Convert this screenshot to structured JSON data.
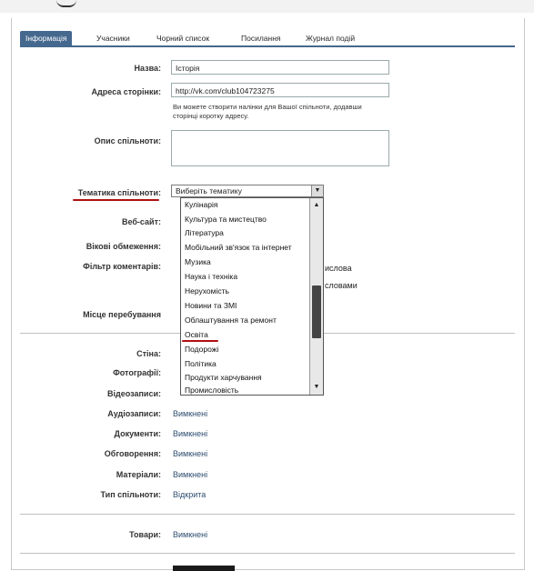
{
  "tabs": [
    {
      "label": "Інформація",
      "active": true
    },
    {
      "label": "Учасники"
    },
    {
      "label": "Чорний список"
    },
    {
      "label": "Посилання"
    },
    {
      "label": "Журнал подій"
    }
  ],
  "form": {
    "name_label": "Назва:",
    "name_value": "Історія",
    "address_label": "Адреса сторінки:",
    "address_prefix": "http://vk.com/",
    "address_value": "club104723275",
    "address_hint": "Ви можете створити налінки для Вашої спільноти, додавши сторінці коротку адресу.",
    "description_label": "Опис спільноти:",
    "description_value": "",
    "topic_label": "Тематика спільноти:",
    "topic_selected": "Виберіть тематику",
    "website_label": "Веб-сайт:",
    "age_label": "Вікові обмеження:",
    "comments_filter_label": "Фільтр коментарів:",
    "comments_opt1_suffix": "ислова",
    "comments_opt2_suffix": "словами",
    "location_label": "Місце перебування"
  },
  "dropdown_options": [
    "Кулінарія",
    "Культура та мистецтво",
    "Література",
    "Мобільний зв'язок та інтернет",
    "Музика",
    "Наука і техніка",
    "Нерухомість",
    "Новини та ЗМІ",
    "Облаштування та ремонт",
    "Освіта",
    "Подорожі",
    "Політика",
    "Продукти харчування",
    "Промисловість"
  ],
  "sections": {
    "wall_label": "Стіна:",
    "photos_label": "Фотографії:",
    "videos_label": "Відеозаписи:",
    "audio_label": "Аудіозаписи:",
    "audio_value": "Вимкнені",
    "documents_label": "Документи:",
    "documents_value": "Вимкнені",
    "discussions_label": "Обговорення:",
    "discussions_value": "Вимкнені",
    "materials_label": "Матеріали:",
    "materials_value": "Вимкнені",
    "community_type_label": "Тип спільноти:",
    "community_type_value": "Відкрита",
    "goods_label": "Товари:",
    "goods_value": "Вимкнені"
  },
  "colors": {
    "accent": "#45688e",
    "underline": "#b01010"
  }
}
